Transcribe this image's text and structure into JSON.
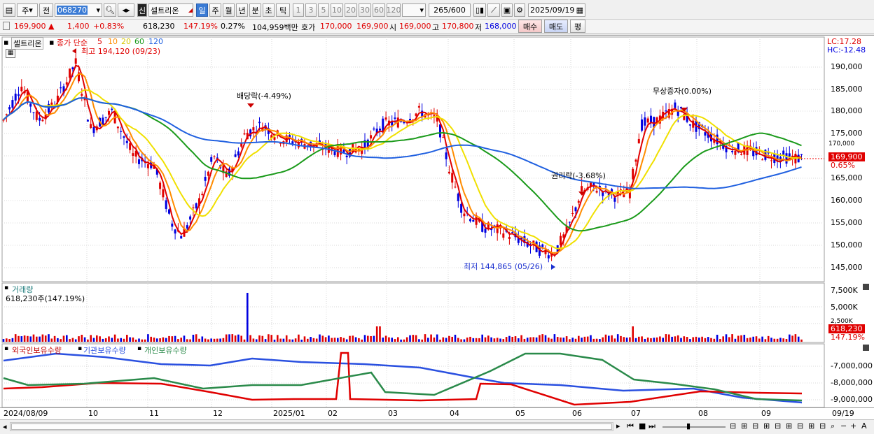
{
  "toolbar": {
    "period_select": "주",
    "prev": "전",
    "code": "068270",
    "badge_new": "신",
    "stock_name": "셀트리온",
    "intervals": [
      "일",
      "주",
      "월",
      "년",
      "분",
      "초",
      "틱"
    ],
    "counts": [
      "1",
      "3",
      "5",
      "10",
      "20",
      "30",
      "60",
      "120"
    ],
    "range_text": "265",
    "range_total": "/600",
    "date": "2025/09/19"
  },
  "quote": {
    "price": "169,900 ▲",
    "change": "1,400",
    "change_pct": "+0.83%",
    "volume": "618,230",
    "vol_ratio": "147.19%",
    "turnover_rate": "0.27%",
    "amount": "104,959백만",
    "ask_label": "호가",
    "ask1": "170,000",
    "bid1": "169,900",
    "open_label": "시",
    "open": "169,000",
    "high_label": "고",
    "high": "170,800",
    "low_label": "저",
    "low": "168,000",
    "buy_btn": "매수",
    "sell_btn": "매도",
    "eval_btn": "평"
  },
  "price_panel": {
    "tab_label": "셀트리온",
    "ma_label": "종가 단순",
    "ma_periods": [
      "5",
      "10",
      "20",
      "60",
      "120"
    ],
    "lc_label": "LC:17.28",
    "hc_label": "HC:-12.48",
    "high_note": "최고 194,120 (09/23)",
    "low_note": "최저 144,865 (05/26)",
    "event_dividend": "배당락(-4.49%)",
    "event_rights": "권리락(-3.68%)",
    "event_bonus": "무상증자(0.00%)",
    "last_price_tag": "169,900",
    "last_pct_tag": "0.65%",
    "y_ticks": [
      "190,000",
      "185,000",
      "180,000",
      "175,000",
      "170,000",
      "165,000",
      "160,000",
      "155,000",
      "150,000",
      "145,000"
    ]
  },
  "volume_panel": {
    "title": "거래량",
    "value": "618,230주(147.19%)",
    "y_ticks": [
      "7,500K",
      "5,000K",
      "2,500K"
    ],
    "tag": "618,230",
    "tag_pct": "147.19%"
  },
  "holding_panel": {
    "series_labels": [
      "외국인보유수량",
      "기관보유수량",
      "개인보유수량"
    ],
    "y_ticks": [
      "-7,000,000",
      "-8,000,000",
      "-9,000,000"
    ]
  },
  "date_axis": {
    "labels": [
      "2024/08/09",
      "10",
      "11",
      "12",
      "2025/01",
      "02",
      "03",
      "04",
      "05",
      "06",
      "07",
      "08",
      "09"
    ],
    "right_label": "09/19"
  },
  "colors": {
    "up": "#e00000",
    "down": "#0000e0",
    "ma5": "#e00000",
    "ma10": "#ff8c00",
    "ma20": "#f0e000",
    "ma60": "#1a9a1a",
    "ma120": "#2060e0",
    "foreign": "#2a50e0",
    "institution": "#e00000",
    "individual": "#2a8a4a"
  }
}
